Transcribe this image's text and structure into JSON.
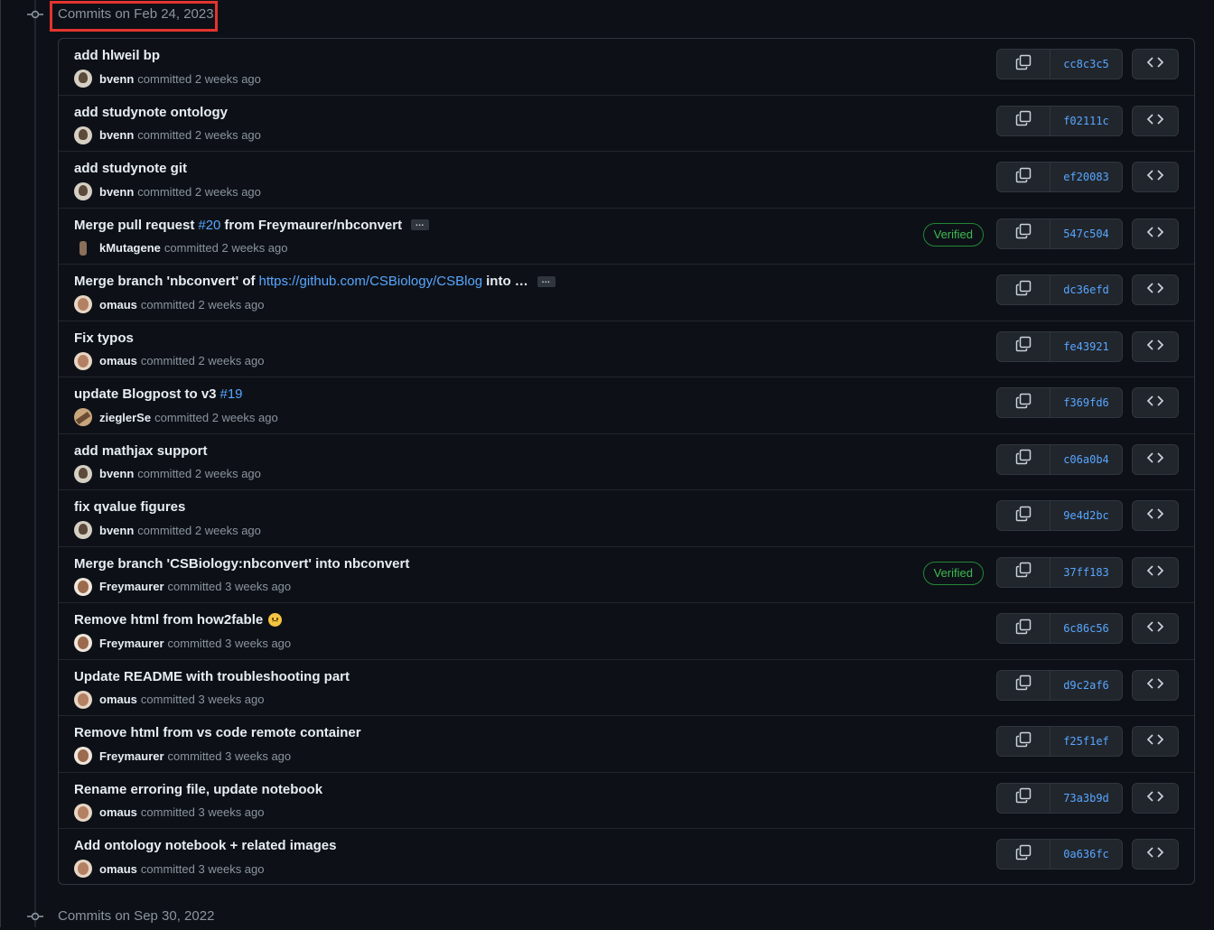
{
  "groups": [
    {
      "title": "Commits on Feb 24, 2023"
    },
    {
      "title": "Commits on Sep 30, 2022"
    }
  ],
  "commits": [
    {
      "parts": [
        {
          "t": "add hlweil bp"
        }
      ],
      "author": "bvenn",
      "action": "committed",
      "time": "2 weeks ago",
      "sha": "cc8c3c5",
      "verified": "",
      "avatar": "a1"
    },
    {
      "parts": [
        {
          "t": "add studynote ontology"
        }
      ],
      "author": "bvenn",
      "action": "committed",
      "time": "2 weeks ago",
      "sha": "f02111c",
      "verified": "",
      "avatar": "a1"
    },
    {
      "parts": [
        {
          "t": "add studynote git"
        }
      ],
      "author": "bvenn",
      "action": "committed",
      "time": "2 weeks ago",
      "sha": "ef20083",
      "verified": "",
      "avatar": "a1"
    },
    {
      "parts": [
        {
          "t": "Merge pull request"
        },
        {
          "t": "#20",
          "link": true
        },
        {
          "t": "from Freymaurer/nbconvert"
        }
      ],
      "ellipsis": "…",
      "author": "kMutagene",
      "action": "committed",
      "time": "2 weeks ago",
      "sha": "547c504",
      "verified": "Verified",
      "avatar": "a2"
    },
    {
      "parts": [
        {
          "t": "Merge branch 'nbconvert' of"
        },
        {
          "t": "https://github.com/CSBiology/CSBlog",
          "link": true
        },
        {
          "t": "into …"
        }
      ],
      "ellipsis": "…",
      "author": "omaus",
      "action": "committed",
      "time": "2 weeks ago",
      "sha": "dc36efd",
      "verified": "",
      "avatar": "a3"
    },
    {
      "parts": [
        {
          "t": "Fix typos"
        }
      ],
      "author": "omaus",
      "action": "committed",
      "time": "2 weeks ago",
      "sha": "fe43921",
      "verified": "",
      "avatar": "a3"
    },
    {
      "parts": [
        {
          "t": "update Blogpost to v3"
        },
        {
          "t": "#19",
          "link": true
        }
      ],
      "author": "zieglerSe",
      "action": "committed",
      "time": "2 weeks ago",
      "sha": "f369fd6",
      "verified": "",
      "avatar": "a4"
    },
    {
      "parts": [
        {
          "t": "add mathjax support"
        }
      ],
      "author": "bvenn",
      "action": "committed",
      "time": "2 weeks ago",
      "sha": "c06a0b4",
      "verified": "",
      "avatar": "a1"
    },
    {
      "parts": [
        {
          "t": "fix qvalue figures"
        }
      ],
      "author": "bvenn",
      "action": "committed",
      "time": "2 weeks ago",
      "sha": "9e4d2bc",
      "verified": "",
      "avatar": "a1"
    },
    {
      "parts": [
        {
          "t": "Merge branch 'CSBiology:nbconvert' into nbconvert"
        }
      ],
      "author": "Freymaurer",
      "action": "committed",
      "time": "3 weeks ago",
      "sha": "37ff183",
      "verified": "Verified",
      "avatar": "a5"
    },
    {
      "parts": [
        {
          "t": "Remove html from how2fable"
        }
      ],
      "emoji": "worried-face",
      "author": "Freymaurer",
      "action": "committed",
      "time": "3 weeks ago",
      "sha": "6c86c56",
      "verified": "",
      "avatar": "a5"
    },
    {
      "parts": [
        {
          "t": "Update README with troubleshooting part"
        }
      ],
      "author": "omaus",
      "action": "committed",
      "time": "3 weeks ago",
      "sha": "d9c2af6",
      "verified": "",
      "avatar": "a3"
    },
    {
      "parts": [
        {
          "t": "Remove html from vs code remote container"
        }
      ],
      "author": "Freymaurer",
      "action": "committed",
      "time": "3 weeks ago",
      "sha": "f25f1ef",
      "verified": "",
      "avatar": "a5"
    },
    {
      "parts": [
        {
          "t": "Rename erroring file, update notebook"
        }
      ],
      "author": "omaus",
      "action": "committed",
      "time": "3 weeks ago",
      "sha": "73a3b9d",
      "verified": "",
      "avatar": "a3"
    },
    {
      "parts": [
        {
          "t": "Add ontology notebook + related images"
        }
      ],
      "author": "omaus",
      "action": "committed",
      "time": "3 weeks ago",
      "sha": "0a636fc",
      "verified": "",
      "avatar": "a3"
    }
  ],
  "icons": {
    "group": "git-commit-icon",
    "copy": "copy-icon",
    "browse": "code-icon"
  },
  "colors": {
    "background": "#0d1117",
    "link": "#58a6ff",
    "verified": "#3fb950",
    "highlight": "#e3342f"
  }
}
